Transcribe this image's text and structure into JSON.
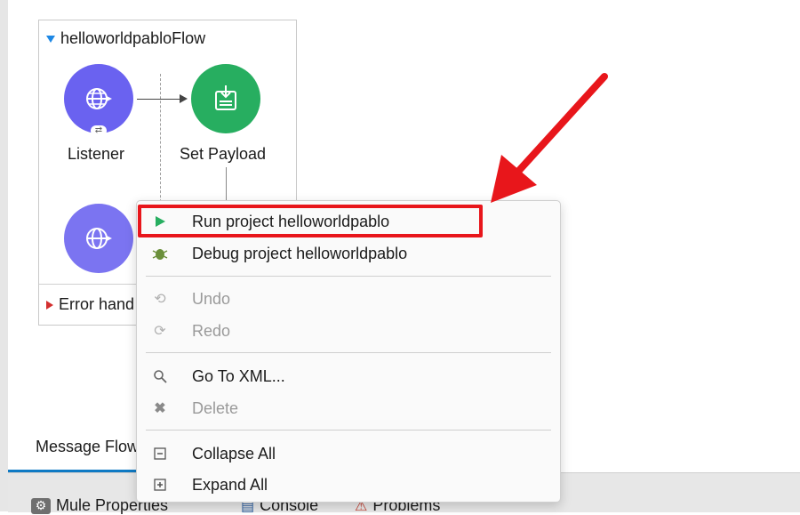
{
  "flow": {
    "name": "helloworldpabloFlow",
    "nodes": [
      {
        "label": "Listener",
        "color": "#6a62f0",
        "icon": "globe-icon"
      },
      {
        "label": "Set Payload",
        "color": "#27ae60",
        "icon": "clipboard-icon"
      },
      {
        "label": "",
        "color": "#7b74f1",
        "icon": "globe-icon"
      }
    ],
    "error_handling": "Error hand"
  },
  "tabs": {
    "message_flow": "Message Flow"
  },
  "bottom_panel": {
    "tabs": [
      "Mule Properties",
      "Console",
      "Problems"
    ]
  },
  "context_menu": {
    "items": [
      {
        "label": "Run project helloworldpablo",
        "enabled": true,
        "icon": "run-icon",
        "highlighted": true
      },
      {
        "label": "Debug project helloworldpablo",
        "enabled": true,
        "icon": "bug-icon"
      },
      {
        "label": "Undo",
        "enabled": false,
        "icon": "undo-icon"
      },
      {
        "label": "Redo",
        "enabled": false,
        "icon": "redo-icon"
      },
      {
        "label": "Go To XML...",
        "enabled": true,
        "icon": "search-icon"
      },
      {
        "label": "Delete",
        "enabled": false,
        "icon": "delete-icon"
      },
      {
        "label": "Collapse All",
        "enabled": true,
        "icon": "collapse-icon"
      },
      {
        "label": "Expand All",
        "enabled": true,
        "icon": "expand-icon"
      }
    ]
  },
  "colors": {
    "annotation_red": "#e8161b",
    "accent_blue": "#0f7ac4"
  }
}
